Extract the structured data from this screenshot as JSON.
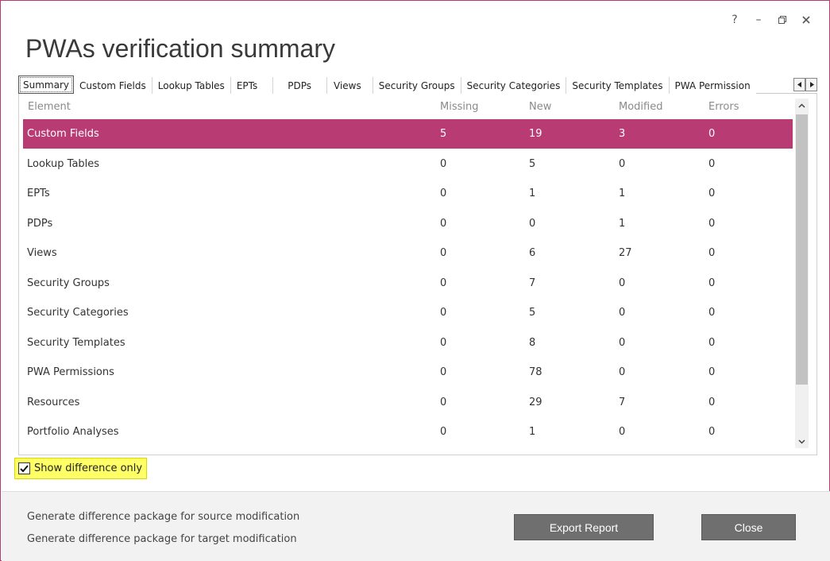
{
  "window": {
    "title": "PWAs verification summary",
    "controls": {
      "help": "?",
      "minimize": "–"
    }
  },
  "tabs": [
    {
      "label": "Summary",
      "active": true
    },
    {
      "label": "Custom Fields"
    },
    {
      "label": "Lookup Tables"
    },
    {
      "label": "EPTs"
    },
    {
      "label": "PDPs"
    },
    {
      "label": "Views"
    },
    {
      "label": "Security Groups"
    },
    {
      "label": "Security Categories"
    },
    {
      "label": "Security Templates"
    },
    {
      "label": "PWA Permission"
    }
  ],
  "table": {
    "columns": [
      "Element",
      "Missing",
      "New",
      "Modified",
      "Errors"
    ],
    "rows": [
      {
        "element": "Custom Fields",
        "missing": "5",
        "new": "19",
        "modified": "3",
        "errors": "0",
        "selected": true
      },
      {
        "element": "Lookup Tables",
        "missing": "0",
        "new": "5",
        "modified": "0",
        "errors": "0"
      },
      {
        "element": "EPTs",
        "missing": "0",
        "new": "1",
        "modified": "1",
        "errors": "0"
      },
      {
        "element": "PDPs",
        "missing": "0",
        "new": "0",
        "modified": "1",
        "errors": "0"
      },
      {
        "element": "Views",
        "missing": "0",
        "new": "6",
        "modified": "27",
        "errors": "0"
      },
      {
        "element": "Security Groups",
        "missing": "0",
        "new": "7",
        "modified": "0",
        "errors": "0"
      },
      {
        "element": "Security Categories",
        "missing": "0",
        "new": "5",
        "modified": "0",
        "errors": "0"
      },
      {
        "element": "Security Templates",
        "missing": "0",
        "new": "8",
        "modified": "0",
        "errors": "0"
      },
      {
        "element": "PWA Permissions",
        "missing": "0",
        "new": "78",
        "modified": "0",
        "errors": "0"
      },
      {
        "element": "Resources",
        "missing": "0",
        "new": "29",
        "modified": "7",
        "errors": "0"
      },
      {
        "element": "Portfolio Analyses",
        "missing": "0",
        "new": "1",
        "modified": "0",
        "errors": "0"
      }
    ]
  },
  "show_difference_only": {
    "label": "Show difference only",
    "checked": true
  },
  "footer": {
    "link_source": "Generate difference package for source modification",
    "link_target": "Generate difference package for target modification",
    "export_label": "Export Report",
    "close_label": "Close"
  },
  "colors": {
    "accent": "#b83b74",
    "highlight": "#ffff66",
    "button": "#6f6f6f"
  }
}
